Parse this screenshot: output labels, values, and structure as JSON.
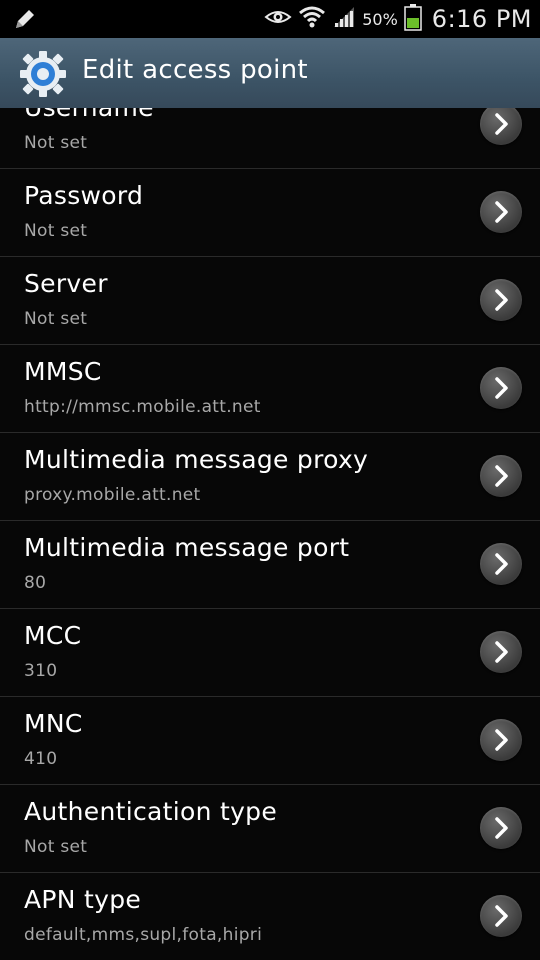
{
  "status_bar": {
    "battery_percent": "50%",
    "time": "6:16 PM",
    "icons": [
      "pencil-icon",
      "eye-icon",
      "wifi-icon",
      "signal-icon",
      "battery-icon"
    ],
    "battery_color": "#6cbf2a"
  },
  "action_bar": {
    "title": "Edit access point",
    "icon": "settings-gear-icon",
    "accent": "#3c5466"
  },
  "items": [
    {
      "title": "Username",
      "value": "Not set"
    },
    {
      "title": "Password",
      "value": "Not set"
    },
    {
      "title": "Server",
      "value": "Not set"
    },
    {
      "title": "MMSC",
      "value": "http://mmsc.mobile.att.net"
    },
    {
      "title": "Multimedia message proxy",
      "value": "proxy.mobile.att.net"
    },
    {
      "title": "Multimedia message port",
      "value": "80"
    },
    {
      "title": "MCC",
      "value": "310"
    },
    {
      "title": "MNC",
      "value": "410"
    },
    {
      "title": "Authentication type",
      "value": "Not set"
    },
    {
      "title": "APN type",
      "value": "default,mms,supl,fota,hipri"
    }
  ]
}
